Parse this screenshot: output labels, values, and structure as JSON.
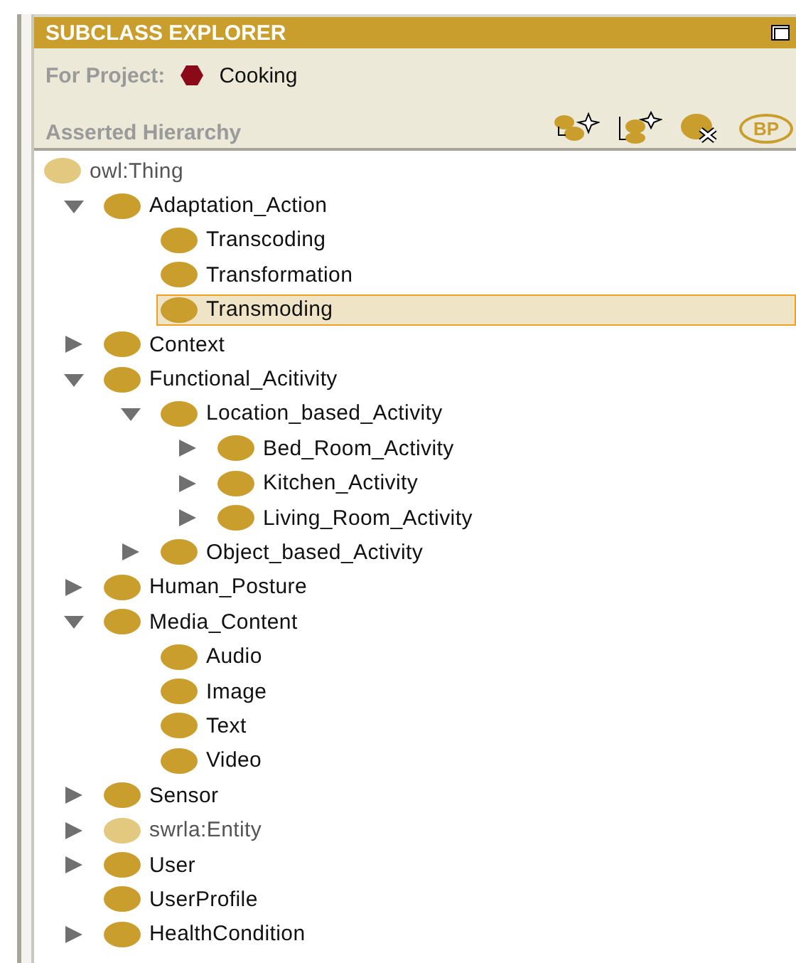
{
  "header": {
    "title": "SUBCLASS EXPLORER"
  },
  "project": {
    "label": "For Project:",
    "name": "Cooking"
  },
  "hierarchy": {
    "title": "Asserted Hierarchy",
    "tools": [
      {
        "kind": "add-subclass"
      },
      {
        "kind": "add-sibling"
      },
      {
        "kind": "delete"
      },
      {
        "kind": "badge",
        "label": "BP"
      }
    ]
  },
  "tree": [
    {
      "label": "owl:Thing",
      "kind": "system",
      "selected": false,
      "children": [
        {
          "label": "Adaptation_Action",
          "kind": "class",
          "expanded": true,
          "selected": false,
          "children": [
            {
              "label": "Transcoding",
              "kind": "class",
              "selected": false
            },
            {
              "label": "Transformation",
              "kind": "class",
              "selected": false
            },
            {
              "label": "Transmoding",
              "kind": "class",
              "selected": true
            }
          ]
        },
        {
          "label": "Context",
          "kind": "class",
          "expanded": false,
          "selected": false
        },
        {
          "label": "Functional_Acitivity",
          "kind": "class",
          "expanded": true,
          "selected": false,
          "children": [
            {
              "label": "Location_based_Activity",
              "kind": "class",
              "expanded": true,
              "selected": false,
              "children": [
                {
                  "label": "Bed_Room_Activity",
                  "kind": "class",
                  "expanded": false,
                  "selected": false
                },
                {
                  "label": "Kitchen_Activity",
                  "kind": "class",
                  "expanded": false,
                  "selected": false
                },
                {
                  "label": "Living_Room_Activity",
                  "kind": "class",
                  "expanded": false,
                  "selected": false
                }
              ]
            },
            {
              "label": "Object_based_Activity",
              "kind": "class",
              "expanded": false,
              "selected": false
            }
          ]
        },
        {
          "label": "Human_Posture",
          "kind": "class",
          "expanded": false,
          "selected": false
        },
        {
          "label": "Media_Content",
          "kind": "class",
          "expanded": true,
          "selected": false,
          "children": [
            {
              "label": "Audio",
              "kind": "class",
              "selected": false
            },
            {
              "label": "Image",
              "kind": "class",
              "selected": false
            },
            {
              "label": "Text",
              "kind": "class",
              "selected": false
            },
            {
              "label": "Video",
              "kind": "class",
              "selected": false
            }
          ]
        },
        {
          "label": "Sensor",
          "kind": "class",
          "expanded": false,
          "selected": false
        },
        {
          "label": "swrla:Entity",
          "kind": "system",
          "expanded": false,
          "selected": false
        },
        {
          "label": "User",
          "kind": "class",
          "expanded": false,
          "selected": false
        },
        {
          "label": "UserProfile",
          "kind": "class",
          "selected": false
        },
        {
          "label": "HealthCondition",
          "kind": "class",
          "expanded": false,
          "selected": false
        }
      ]
    }
  ]
}
